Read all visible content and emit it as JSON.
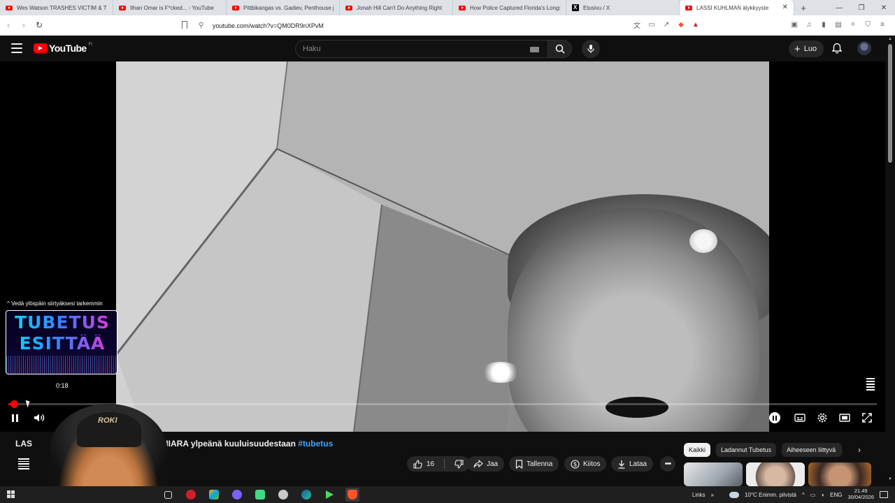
{
  "browser": {
    "tabs": [
      {
        "title": "Wes Watson TRASHES VICTIM & The",
        "icon": "youtube-icon",
        "active": false
      },
      {
        "title": "Ilhan Omar is F*cked... - YouTube",
        "icon": "youtube-icon",
        "active": false
      },
      {
        "title": "Pittbikangas vs. Gadiev, Penthouse ja",
        "icon": "youtube-icon",
        "active": false
      },
      {
        "title": "Jonah Hill Can't Do Anything Right",
        "icon": "youtube-icon",
        "active": false
      },
      {
        "title": "How Police Captured Florida's Longs",
        "icon": "youtube-icon",
        "active": false
      },
      {
        "title": "Etusivu / X",
        "icon": "x-icon",
        "active": false
      },
      {
        "title": "LASSI KUHLMAN älykkyyste",
        "icon": "youtube-icon",
        "active": true
      }
    ],
    "url": "youtube.com/watch?v=QM0DR9nXPvM"
  },
  "masthead": {
    "logo_text": "YouTube",
    "region": "FI",
    "search_placeholder": "Haku",
    "create_label": "Luo"
  },
  "player": {
    "preview_hint": "Vedä ylöspäin siirtyäksesi tarkemmin",
    "preview_thumb_line1": "TUBETUS",
    "preview_thumb_line2": "ESITTÄÄ",
    "preview_time": "0:18",
    "progress_fraction": 0.006
  },
  "video": {
    "title_visible_start": "LAS",
    "title_visible_end": "ä - CHIARA ylpeänä kuuluisuudestaan ",
    "hashtag": "#tubetus",
    "webcam_cap_text": "ROKI"
  },
  "actions": {
    "like_count": "16",
    "share": "Jaa",
    "save": "Tallenna",
    "thanks": "Kiitos",
    "download": "Lataa"
  },
  "chips": [
    "Kaikki",
    "Ladannut Tubetus",
    "Aiheeseen liittyvä"
  ],
  "taskbar": {
    "links": "Links",
    "weather": "10°C  Enimm. pilvistä",
    "lang": "ENG",
    "time": "21.49",
    "date": "30/04/2026"
  },
  "colors": {
    "accent_red": "#ff0000",
    "hashtag_blue": "#3ea6ff",
    "yt_bg": "#0f0f0f"
  }
}
